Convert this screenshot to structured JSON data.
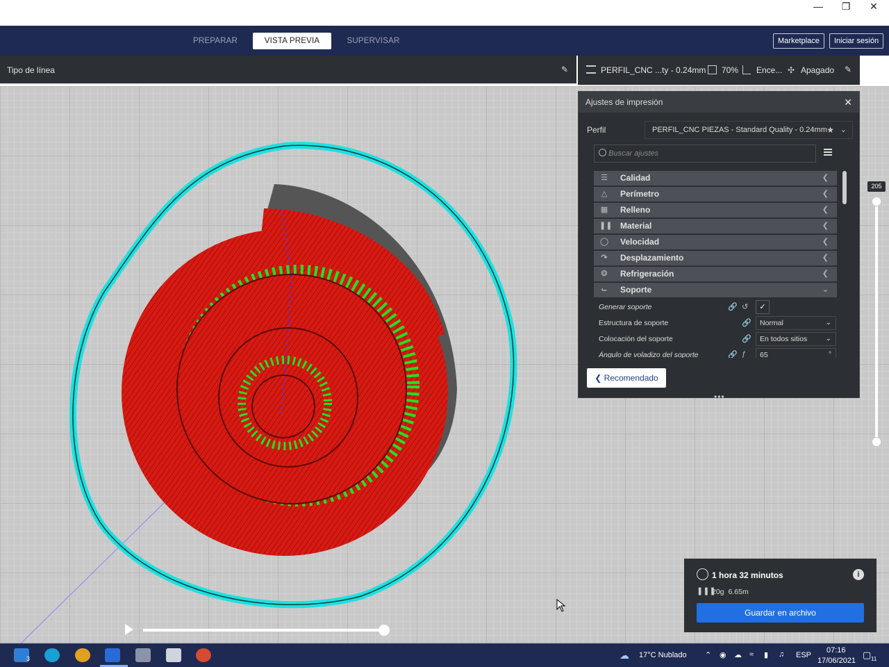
{
  "window": {
    "minimize_icon": "minimize-icon",
    "restore_icon": "restore-icon",
    "close_icon": "close-icon"
  },
  "nav": {
    "tabs": [
      {
        "label": "PREPARAR",
        "active": false
      },
      {
        "label": "VISTA PREVIA",
        "active": true
      },
      {
        "label": "SUPERVISAR",
        "active": false
      }
    ],
    "marketplace": "Marketplace",
    "login": "Iniciar sesión"
  },
  "viewbar": {
    "line_type_label": "Tipo de línea"
  },
  "printbar": {
    "profile": "PERFIL_CNC ...ty - 0.24mm",
    "infill": "70%",
    "support": "Ence...",
    "adhesion": "Apagado"
  },
  "settings": {
    "title": "Ajustes de impresión",
    "profile_label": "Perfil",
    "profile_value": "PERFIL_CNC PIEZAS - Standard Quality - 0.24mm",
    "search_placeholder": "Buscar ajustes",
    "categories": [
      {
        "label": "Calidad",
        "icon": "quality-icon",
        "expanded": false
      },
      {
        "label": "Perímetro",
        "icon": "perimeter-icon",
        "expanded": false
      },
      {
        "label": "Relleno",
        "icon": "infill-icon",
        "expanded": false
      },
      {
        "label": "Material",
        "icon": "material-icon",
        "expanded": false
      },
      {
        "label": "Velocidad",
        "icon": "speed-icon",
        "expanded": false
      },
      {
        "label": "Desplazamiento",
        "icon": "travel-icon",
        "expanded": false
      },
      {
        "label": "Refrigeración",
        "icon": "cooling-icon",
        "expanded": false
      },
      {
        "label": "Soporte",
        "icon": "support-icon",
        "expanded": true
      }
    ],
    "support_rows": [
      {
        "label": "Generar soporte",
        "type": "checkbox",
        "checked": true
      },
      {
        "label": "Estructura de soporte",
        "type": "select",
        "value": "Normal"
      },
      {
        "label": "Colocación del soporte",
        "type": "select",
        "value": "En todos sitios"
      },
      {
        "label": "Ángulo de voladizo del soporte",
        "type": "number",
        "value": "65",
        "unit": "°"
      }
    ],
    "recommended_label": "Recomendado"
  },
  "layer_slider": {
    "top_value": "205"
  },
  "estimate": {
    "time": "1 hora 32 minutos",
    "weight": "20g",
    "length": "6.65m",
    "save_label": "Guardar en archivo"
  },
  "taskbar": {
    "mail_badge": "3",
    "weather": "17°C  Nublado",
    "lang": "ESP",
    "time": "07:16",
    "date": "17/06/2021",
    "notif_badge": "11"
  },
  "colors": {
    "nav_bg": "#1f2a52",
    "panel_bg": "#2c2f33",
    "accent_blue": "#2170e3",
    "model_red": "#d81a12",
    "support_green": "#22e022",
    "skirt_cyan": "#1ee0e0"
  }
}
